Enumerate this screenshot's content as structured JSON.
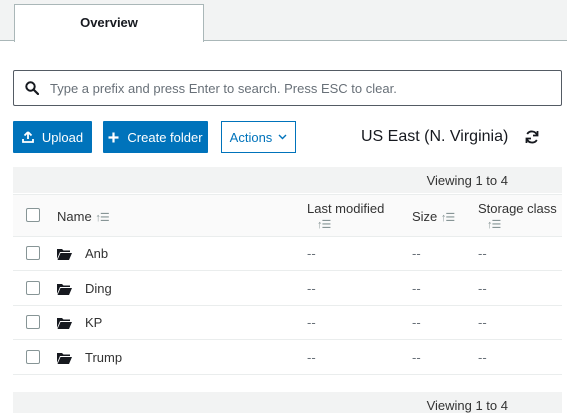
{
  "tabs": [
    {
      "label": "Overview"
    }
  ],
  "search": {
    "placeholder": "Type a prefix and press Enter to search. Press ESC to clear."
  },
  "toolbar": {
    "upload_label": "Upload",
    "create_folder_label": "Create folder",
    "actions_label": "Actions",
    "region": "US East (N. Virginia)"
  },
  "pagination": {
    "viewing_top": "Viewing 1 to 4",
    "viewing_bottom": "Viewing 1 to 4"
  },
  "table": {
    "columns": {
      "name": "Name",
      "last_modified": "Last modified",
      "size": "Size",
      "storage_class": "Storage class"
    },
    "sort_glyph": "↑☰",
    "rows": [
      {
        "name": "Anb",
        "last_modified": "--",
        "size": "--",
        "storage_class": "--"
      },
      {
        "name": "Ding",
        "last_modified": "--",
        "size": "--",
        "storage_class": "--"
      },
      {
        "name": "KP",
        "last_modified": "--",
        "size": "--",
        "storage_class": "--"
      },
      {
        "name": "Trump",
        "last_modified": "--",
        "size": "--",
        "storage_class": "--"
      }
    ]
  },
  "icons": {
    "search": "search-icon",
    "upload": "upload-icon",
    "plus": "plus-icon",
    "chevron": "chevron-down-icon",
    "refresh": "refresh-icon",
    "folder": "folder-icon"
  },
  "colors": {
    "primary": "#0073bb",
    "text": "#333333",
    "muted": "#687078",
    "band": "#f2f3f3"
  }
}
